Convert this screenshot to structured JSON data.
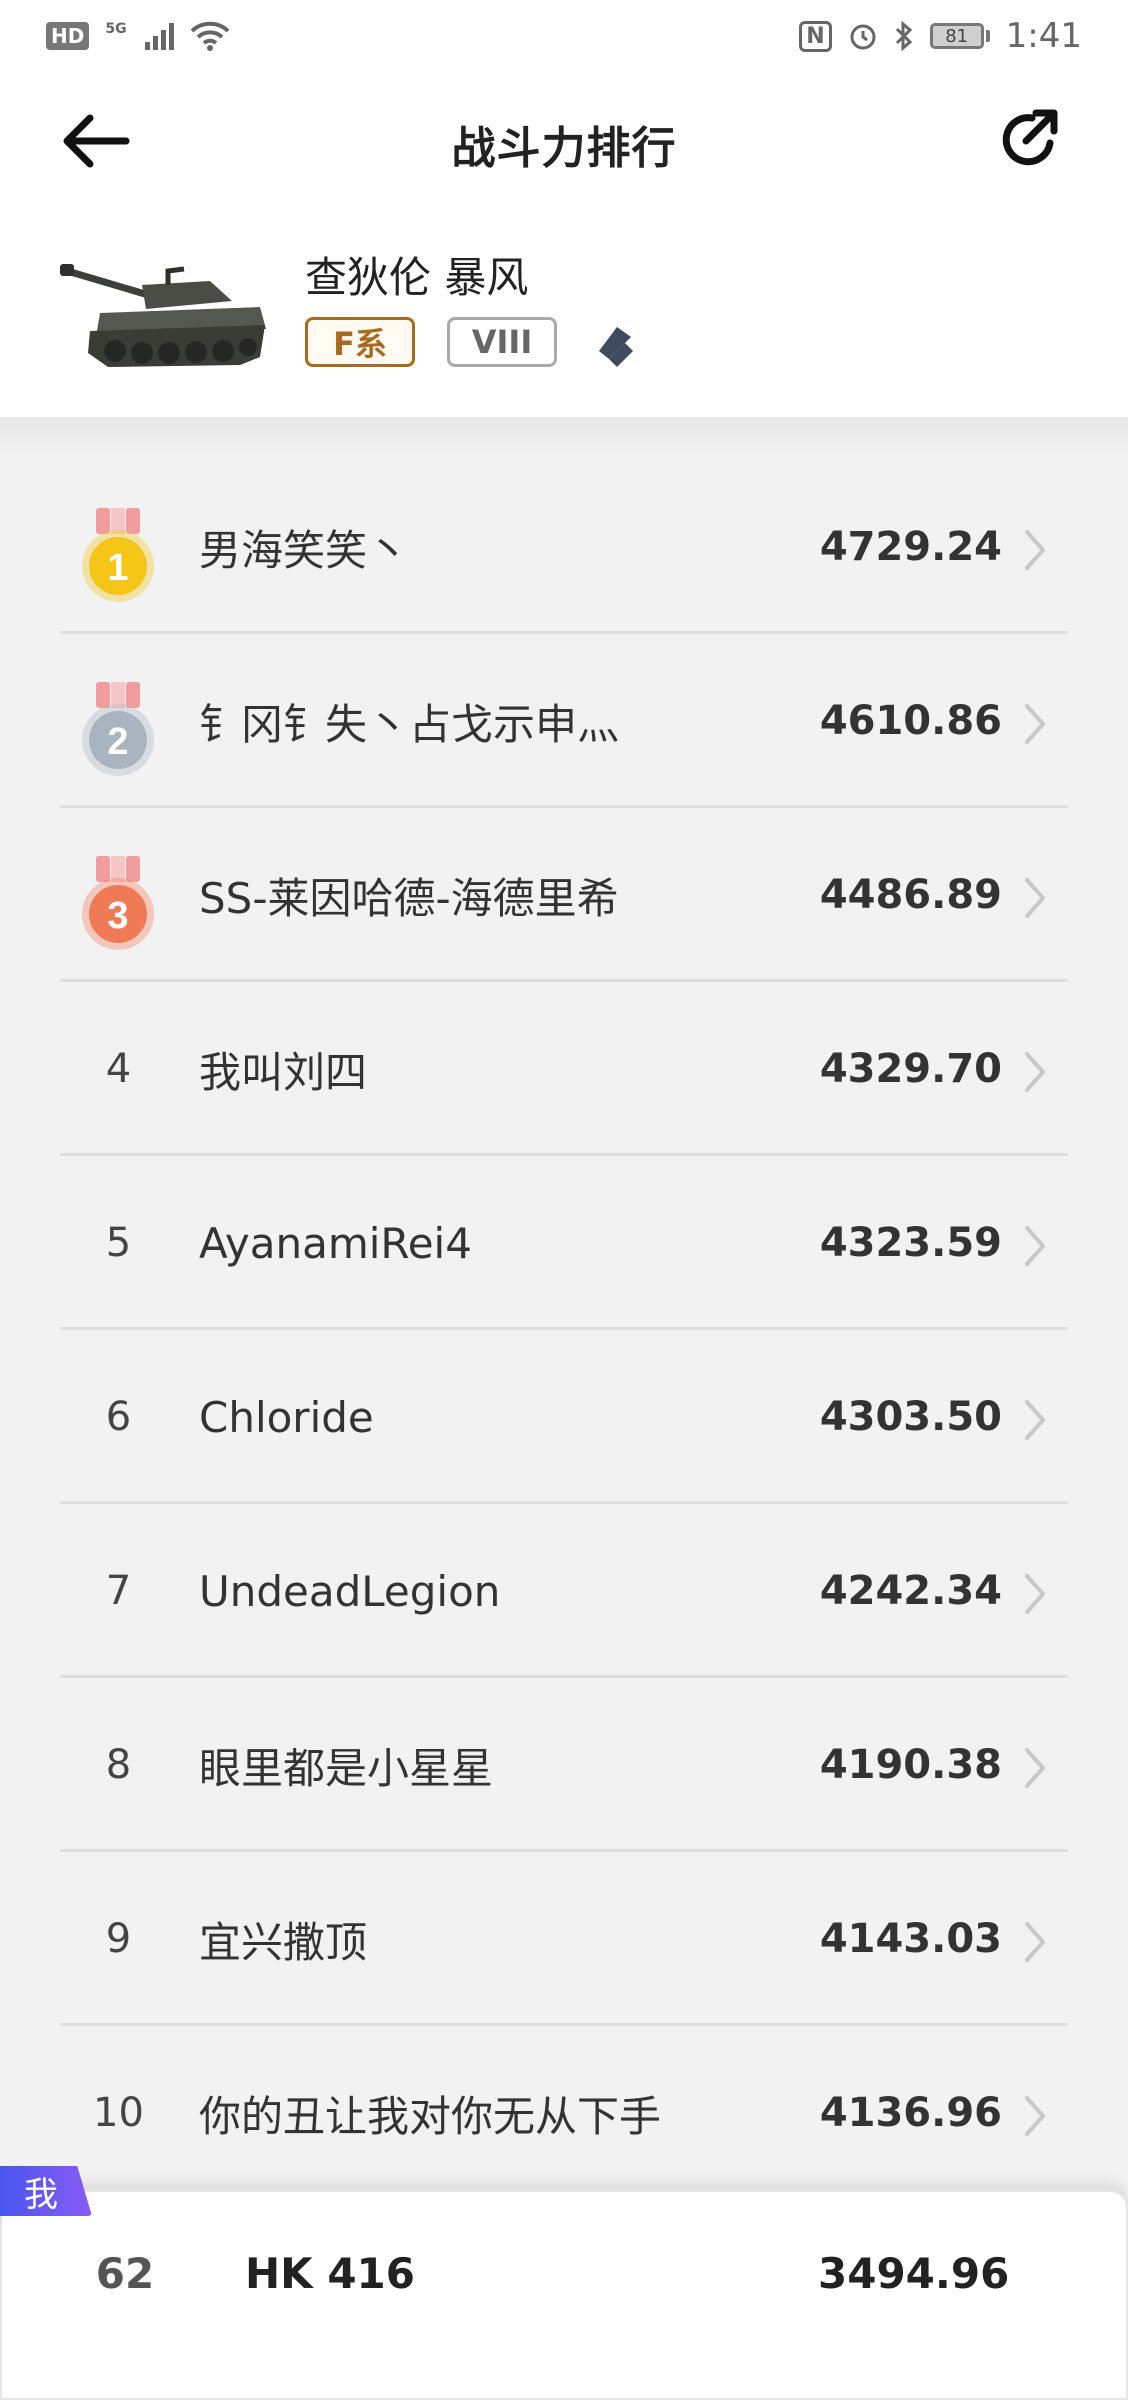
{
  "status_bar": {
    "hd": "HD",
    "network": "5G",
    "nfc": "N",
    "battery": "81",
    "time": "1:41"
  },
  "header": {
    "title": "战斗力排行"
  },
  "tank": {
    "name": "查狄伦 暴风",
    "nation": "F系",
    "tier": "VIII",
    "type_icon": "medium-tank-icon"
  },
  "ranking": [
    {
      "rank": "1",
      "name": "男海笑笑丶",
      "score": "4729.24",
      "medal": "gold"
    },
    {
      "rank": "2",
      "name": "钅冈钅失丶占戈示申灬",
      "score": "4610.86",
      "medal": "silver"
    },
    {
      "rank": "3",
      "name": "SS-莱因哈德-海德里希",
      "score": "4486.89",
      "medal": "bronze"
    },
    {
      "rank": "4",
      "name": "我叫刘四",
      "score": "4329.70"
    },
    {
      "rank": "5",
      "name": "AyanamiRei4",
      "score": "4323.59"
    },
    {
      "rank": "6",
      "name": "Chloride",
      "score": "4303.50"
    },
    {
      "rank": "7",
      "name": "UndeadLegion",
      "score": "4242.34"
    },
    {
      "rank": "8",
      "name": "眼里都是小星星",
      "score": "4190.38"
    },
    {
      "rank": "9",
      "name": "宜兴撒顶",
      "score": "4143.03"
    },
    {
      "rank": "10",
      "name": "你的丑让我对你无从下手",
      "score": "4136.96"
    }
  ],
  "me": {
    "badge": "我",
    "rank": "62",
    "name": "HK 416",
    "score": "3494.96"
  },
  "colors": {
    "gold": "#f5c518",
    "silver": "#a9b4c0",
    "bronze": "#f07a55",
    "nation": "#a86b1e",
    "me_badge": "#5a55f0"
  }
}
